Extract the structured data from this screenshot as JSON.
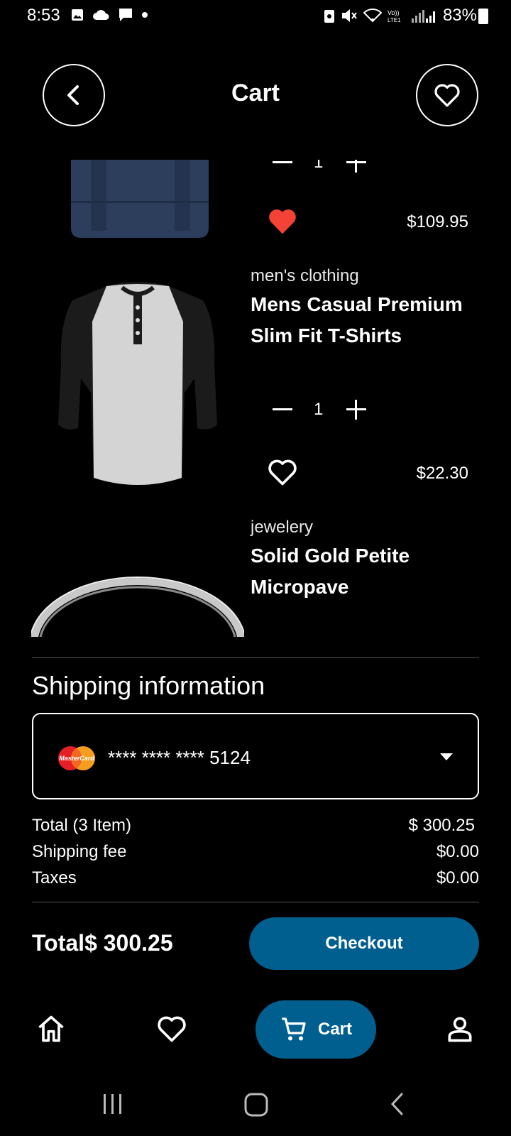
{
  "status_bar": {
    "time": "8:53",
    "battery": "83%",
    "left_icons": [
      "image-icon",
      "cloud-icon",
      "message-icon",
      "dot-icon"
    ],
    "right_icons": [
      "alarm-icon",
      "mute-icon",
      "wifi-icon",
      "volte-icon",
      "signal-icon",
      "battery-icon"
    ]
  },
  "header": {
    "title": "Cart"
  },
  "items": [
    {
      "category": "",
      "title": "",
      "quantity": "1",
      "price": "$109.95",
      "favorite": true
    },
    {
      "category": "men's clothing",
      "title": "Mens Casual Premium Slim Fit T-Shirts",
      "quantity": "1",
      "price": "$22.30",
      "favorite": false
    },
    {
      "category": "jewelery",
      "title": "Solid Gold Petite Micropave",
      "quantity": "",
      "price": "",
      "favorite": false
    }
  ],
  "shipping": {
    "title": "Shipping information",
    "card_number": "**** **** **** 5124",
    "card_brand": "MasterCard"
  },
  "summary": {
    "total_label": "Total (3 Item)",
    "total_value": "$ 300.25",
    "shipping_label": "Shipping fee",
    "shipping_value": "$0.00",
    "taxes_label": "Taxes",
    "taxes_value": "$0.00"
  },
  "footer": {
    "grand_total": "Total$ 300.25",
    "checkout_label": "Checkout"
  },
  "bottom_nav": {
    "cart_label": "Cart"
  },
  "colors": {
    "background": "#000000",
    "accent": "#005f8f",
    "favorite": "#f44336"
  }
}
